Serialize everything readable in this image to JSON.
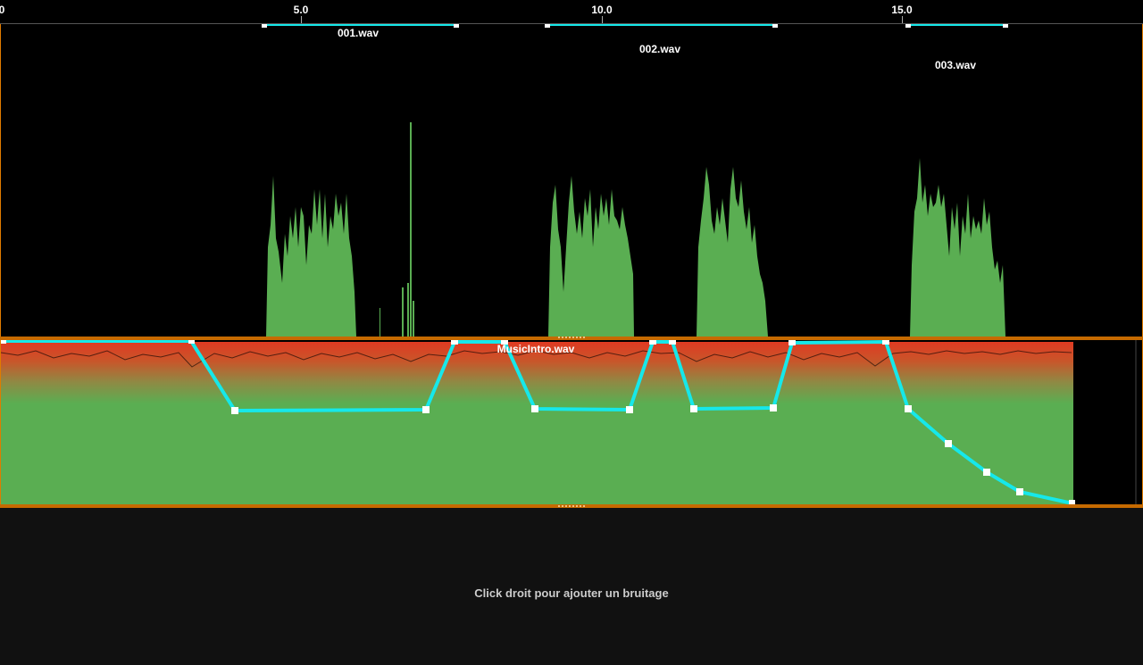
{
  "colors": {
    "track_border": "#c66a00",
    "waveform_green": "#5aae52",
    "waveform_peak_red": "#d9402a",
    "envelope_cyan": "#16e8ea",
    "background": "#000000",
    "empty_zone": "#111111"
  },
  "ruler": {
    "labels": [
      "0",
      "5.0",
      "10.0",
      "15.0"
    ]
  },
  "voice_track": {
    "clips": [
      {
        "name": "001.wav"
      },
      {
        "name": "002.wav"
      },
      {
        "name": "003.wav"
      }
    ]
  },
  "music_track": {
    "clip_name": "MusicIntro.wav"
  },
  "empty_zone": {
    "hint": "Click droit pour ajouter un bruitage"
  }
}
